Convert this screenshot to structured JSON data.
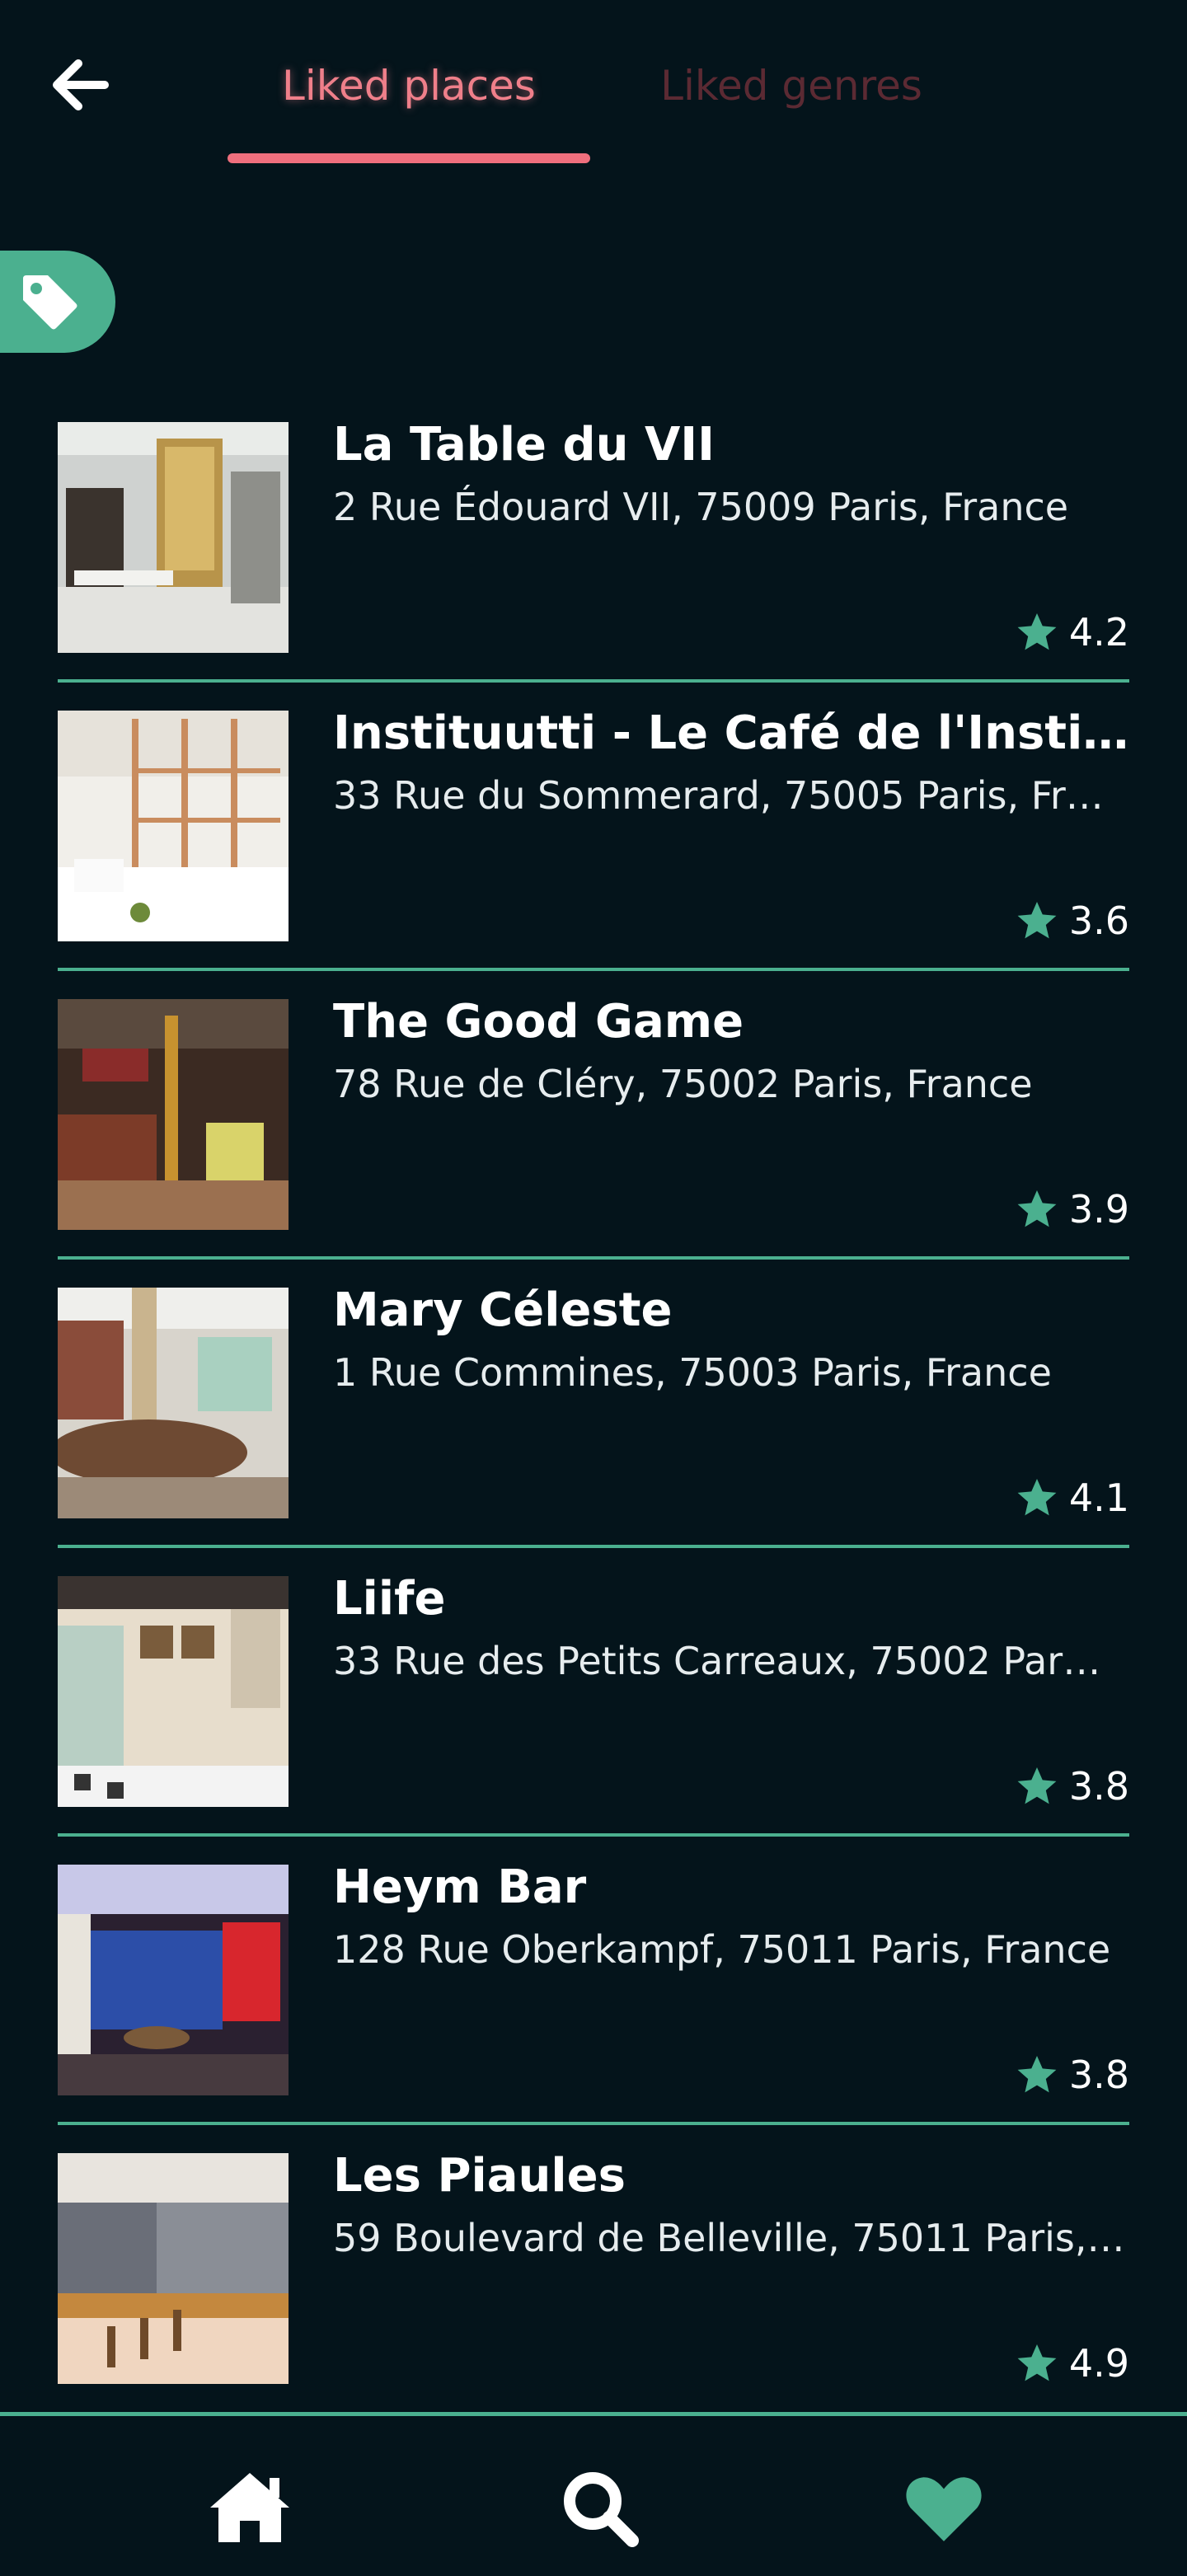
{
  "header": {
    "tabs": [
      {
        "label": "Liked places",
        "active": true
      },
      {
        "label": "Liked genres",
        "active": false
      }
    ]
  },
  "icons": {
    "back": "arrow-left-icon",
    "filter": "tag-icon",
    "rating": "star-icon",
    "nav_home": "home-icon",
    "nav_search": "search-icon",
    "nav_liked": "heart-icon"
  },
  "colors": {
    "background": "#04141b",
    "accent_green": "#4bb08f",
    "accent_pink": "#ef6f7d"
  },
  "places": [
    {
      "name": "La Table du VII",
      "address": "2 Rue Édouard VII, 75009 Paris, France",
      "rating": "4.2"
    },
    {
      "name": "Instituutti - Le Café de l'Institut…",
      "address": "33 Rue du Sommerard, 75005 Paris, Fr…",
      "rating": "3.6"
    },
    {
      "name": "The Good Game",
      "address": "78 Rue de Cléry, 75002 Paris, France",
      "rating": "3.9"
    },
    {
      "name": "Mary Céleste",
      "address": "1 Rue Commines, 75003 Paris, France",
      "rating": "4.1"
    },
    {
      "name": "Liife",
      "address": "33 Rue des Petits Carreaux, 75002 Par…",
      "rating": "3.8"
    },
    {
      "name": "Heym Bar",
      "address": "128 Rue Oberkampf, 75011 Paris, France",
      "rating": "3.8"
    },
    {
      "name": "Les Piaules",
      "address": "59 Boulevard de Belleville, 75011 Paris,…",
      "rating": "4.9"
    }
  ]
}
